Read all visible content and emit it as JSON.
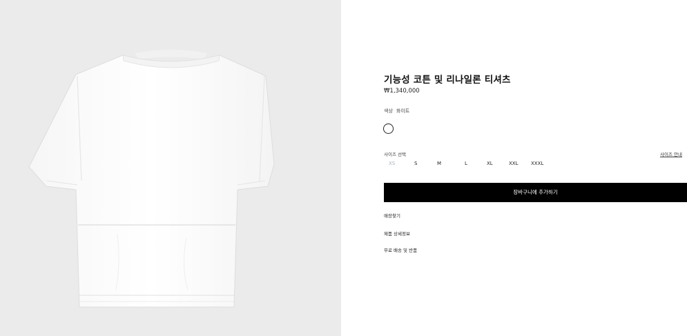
{
  "product": {
    "title": "기능성 코튼 및 리나일론 티셔츠",
    "price": "₩1,340,000",
    "color_label": "색상",
    "color_value": "화이트",
    "swatch_color": "#ffffff",
    "size_label": "사이즈 선택",
    "size_guide": "사이즈 안내",
    "sizes": [
      "XS",
      "S",
      "M",
      "L",
      "XL",
      "XXL",
      "XXXL"
    ],
    "add_to_cart": "장바구니에 추가하기",
    "links": [
      "매장찾기",
      "제품 상세정보",
      "무료 배송 및 반품"
    ]
  },
  "image": {
    "background": "#ebebeb",
    "product_color": "white"
  }
}
